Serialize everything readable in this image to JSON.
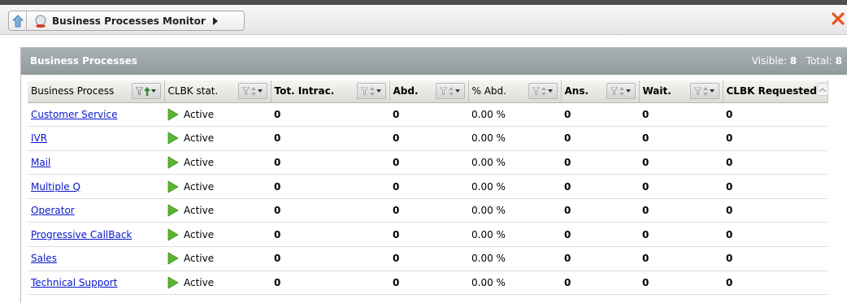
{
  "header": {
    "breadcrumb_title": "Business Processes Monitor"
  },
  "panel": {
    "title": "Business Processes",
    "visible_label": "Visible:",
    "visible_count": "8",
    "total_label": "Total:",
    "total_count": "8"
  },
  "table": {
    "columns": [
      "Business Process",
      "CLBK stat.",
      "Tot. Intrac.",
      "Abd.",
      "% Abd.",
      "Ans.",
      "Wait.",
      "CLBK Requested"
    ],
    "rows": [
      {
        "name": "Customer Service",
        "status": "Active",
        "tot": "0",
        "abd": "0",
        "pct": "0.00 %",
        "ans": "0",
        "wait": "0",
        "clbk": "0"
      },
      {
        "name": "IVR",
        "status": "Active",
        "tot": "0",
        "abd": "0",
        "pct": "0.00 %",
        "ans": "0",
        "wait": "0",
        "clbk": "0"
      },
      {
        "name": "Mail",
        "status": "Active",
        "tot": "0",
        "abd": "0",
        "pct": "0.00 %",
        "ans": "0",
        "wait": "0",
        "clbk": "0"
      },
      {
        "name": "Multiple Q",
        "status": "Active",
        "tot": "0",
        "abd": "0",
        "pct": "0.00 %",
        "ans": "0",
        "wait": "0",
        "clbk": "0"
      },
      {
        "name": "Operator",
        "status": "Active",
        "tot": "0",
        "abd": "0",
        "pct": "0.00 %",
        "ans": "0",
        "wait": "0",
        "clbk": "0"
      },
      {
        "name": "Progressive CallBack",
        "status": "Active",
        "tot": "0",
        "abd": "0",
        "pct": "0.00 %",
        "ans": "0",
        "wait": "0",
        "clbk": "0"
      },
      {
        "name": "Sales",
        "status": "Active",
        "tot": "0",
        "abd": "0",
        "pct": "0.00 %",
        "ans": "0",
        "wait": "0",
        "clbk": "0"
      },
      {
        "name": "Technical Support",
        "status": "Active",
        "tot": "0",
        "abd": "0",
        "pct": "0.00 %",
        "ans": "0",
        "wait": "0",
        "clbk": "0"
      }
    ]
  },
  "icons": {
    "home": "home-icon",
    "process": "business-process-icon",
    "close": "close-icon",
    "filter": "filter-icon",
    "sort": "sort-icon",
    "status": "play-icon"
  },
  "colors": {
    "link": "#0a16c9",
    "panel_header": "#a2aaad",
    "status_green": "#5cb531",
    "close_red": "#e8531c",
    "sort_active": "#2e8b2e"
  }
}
